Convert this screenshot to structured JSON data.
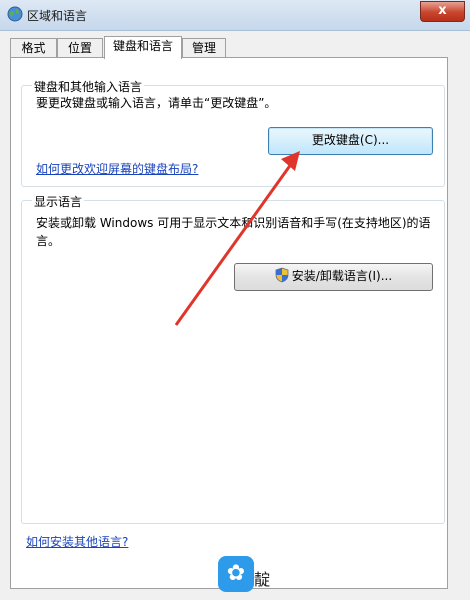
{
  "window": {
    "title": "区域和语言",
    "close_label": "x"
  },
  "tabs": [
    {
      "label": "格式"
    },
    {
      "label": "位置"
    },
    {
      "label": "键盘和语言"
    },
    {
      "label": "管理"
    }
  ],
  "keyboard_group": {
    "title": "键盘和其他输入语言",
    "description": "要更改键盘或输入语言，请单击“更改键盘”。",
    "change_keyboard_button": "更改键盘(C)...",
    "welcome_screen_link": "如何更改欢迎屏幕的键盘布局?"
  },
  "display_group": {
    "title": "显示语言",
    "description_line1": "安装或卸载 Windows 可用于显示文本和识别语音和手写(在支持地区)的语",
    "description_line2": "言。",
    "install_button": "安装/卸载语言(I)..."
  },
  "footer_link": "如何安装其他语言?",
  "watermark": {
    "text": "靛"
  },
  "colors": {
    "arrow": "#e0352b",
    "link": "#1a44bb",
    "close_button": "#c8452e"
  },
  "icons": [
    "globe-icon",
    "close-icon",
    "uac-shield-icon",
    "bird-logo-icon"
  ]
}
